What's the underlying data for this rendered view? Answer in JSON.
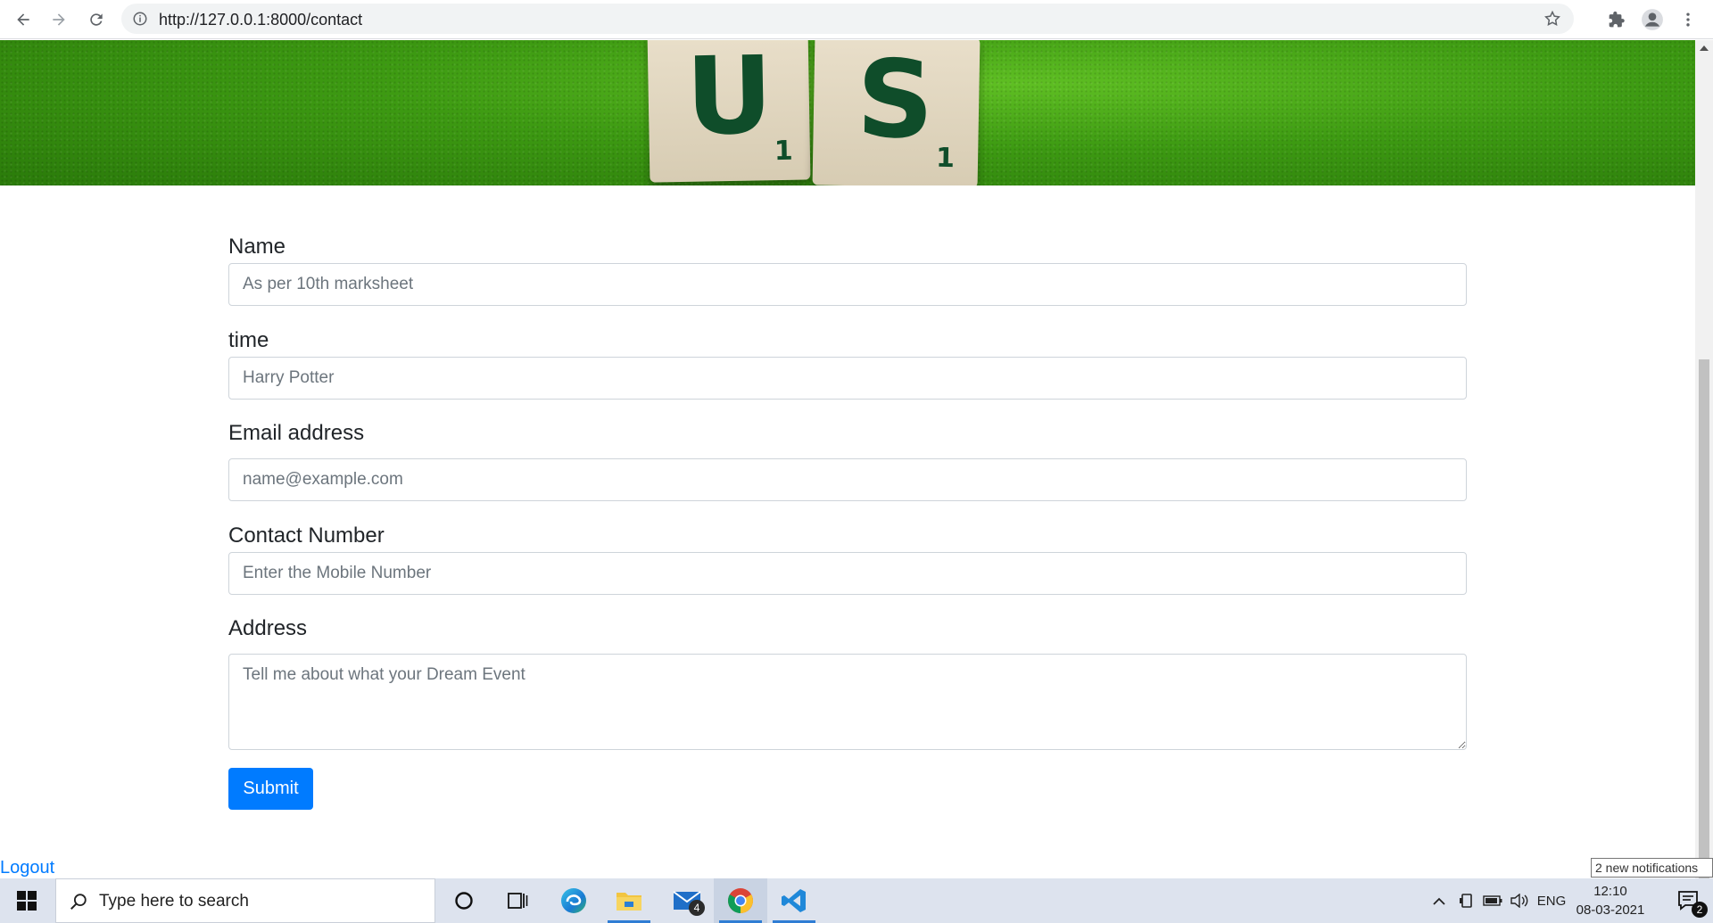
{
  "browser": {
    "url": "http://127.0.0.1:8000/contact"
  },
  "hero": {
    "tiles": [
      {
        "letter": "U",
        "points": "1"
      },
      {
        "letter": "S",
        "points": "1"
      }
    ]
  },
  "form": {
    "name_label": "Name",
    "name_placeholder": "As per 10th marksheet",
    "time_label": "time",
    "time_placeholder": "Harry Potter",
    "email_label": "Email address",
    "email_placeholder": "name@example.com",
    "contact_label": "Contact Number",
    "contact_placeholder": "Enter the Mobile Number",
    "address_label": "Address",
    "address_placeholder": "Tell me about what your Dream Event",
    "submit_label": "Submit"
  },
  "logout_label": "Logout",
  "taskbar": {
    "search_placeholder": "Type here to search",
    "mail_badge": "4",
    "lang": "ENG",
    "time": "12:10",
    "date": "08-03-2021",
    "notification_count": "2",
    "notification_tooltip": "2 new notifications"
  },
  "colors": {
    "primary": "#007bff",
    "hero_green": "#3d9a12",
    "tile_text": "#0f4d2a"
  }
}
